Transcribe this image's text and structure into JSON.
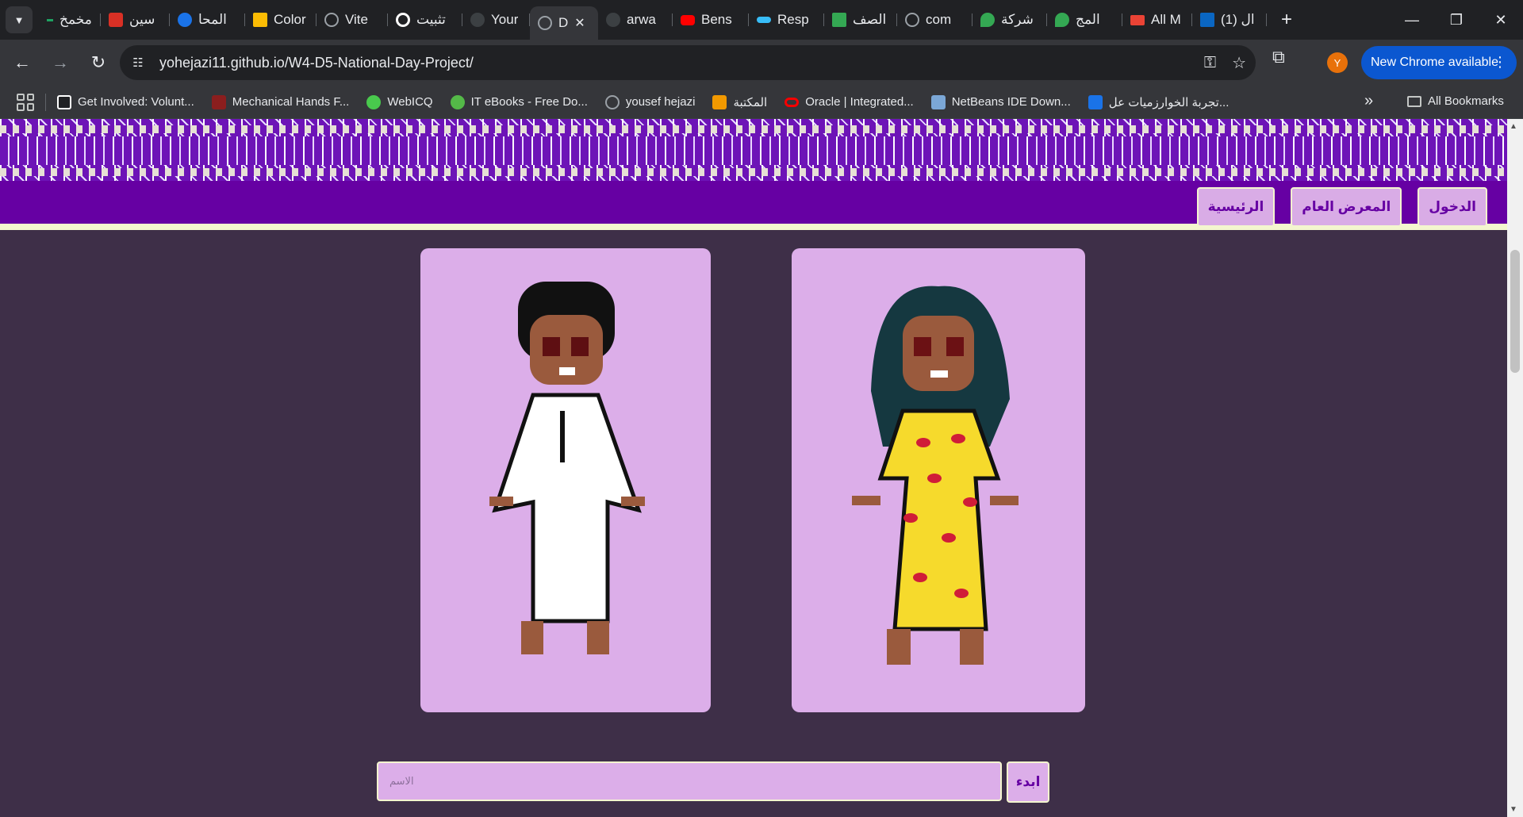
{
  "browser": {
    "tabs": [
      {
        "title": "مخمخ",
        "icon": "green-dot-icon",
        "color": "#1ea362"
      },
      {
        "title": "سين",
        "icon": "arabic-logo-icon",
        "color": "#d93025"
      },
      {
        "title": "المحا",
        "icon": "blue-circle-icon",
        "color": "#1a73e8"
      },
      {
        "title": "Color",
        "icon": "flag-icon",
        "color": "#fbbc04"
      },
      {
        "title": "Vite",
        "icon": "globe-icon",
        "color": "#9aa0a6"
      },
      {
        "title": "تثبيت",
        "icon": "openai-icon",
        "color": "#ffffff"
      },
      {
        "title": "Your",
        "icon": "github-icon",
        "color": "#9aa0a6"
      },
      {
        "title": "D",
        "icon": "globe-icon",
        "color": "#9aa0a6",
        "active": true
      },
      {
        "title": "arwa",
        "icon": "github-icon",
        "color": "#9aa0a6"
      },
      {
        "title": "Bens",
        "icon": "youtube-icon",
        "color": "#ff0000"
      },
      {
        "title": "Resp",
        "icon": "tailwind-icon",
        "color": "#38bdf8"
      },
      {
        "title": "الصف",
        "icon": "sheets-icon",
        "color": "#34a853"
      },
      {
        "title": "com",
        "icon": "globe-icon",
        "color": "#9aa0a6"
      },
      {
        "title": "شركة",
        "icon": "maps-pin-icon",
        "color": "#34a853"
      },
      {
        "title": "المج",
        "icon": "maps-pin-icon",
        "color": "#34a853"
      },
      {
        "title": "All M",
        "icon": "gmail-icon",
        "color": "#ea4335"
      },
      {
        "title": "(1) ال",
        "icon": "linkedin-icon",
        "color": "#0a66c2"
      }
    ],
    "url": "yohejazi11.github.io/W4-D5-National-Day-Project/",
    "update_label": "New Chrome available",
    "avatar_letter": "Y",
    "bookmarks": [
      {
        "label": "Get Involved: Volunt...",
        "icon": "m-icon",
        "color": "#ffffff"
      },
      {
        "label": "Mechanical Hands F...",
        "icon": "red-hand-icon",
        "color": "#8b1e1e"
      },
      {
        "label": "WebICQ",
        "icon": "flower-icon",
        "color": "#49c94d"
      },
      {
        "label": "IT eBooks - Free Do...",
        "icon": "green-ball-icon",
        "color": "#54b948"
      },
      {
        "label": "yousef hejazi",
        "icon": "globe-icon",
        "color": "#9aa0a6"
      },
      {
        "label": "المكتبة",
        "icon": "library-icon",
        "color": "#f29900"
      },
      {
        "label": "Oracle | Integrated...",
        "icon": "oracle-icon",
        "color": "#f80000"
      },
      {
        "label": "NetBeans IDE Down...",
        "icon": "netbeans-icon",
        "color": "#7ba7d6"
      },
      {
        "label": "تجربة الخوارزميات عل...",
        "icon": "h-icon",
        "color": "#1a73e8"
      }
    ],
    "all_bookmarks": "All Bookmarks"
  },
  "page": {
    "nav_buttons": [
      "الدخول",
      "المعرض العام",
      "الرئيسية"
    ],
    "name_placeholder": "الاسم",
    "start_label": "ابدء",
    "colors": {
      "background": "#3e2f48",
      "navbar": "#6600a3",
      "card": "#dcaee9",
      "accent_border": "#f4f6cf"
    },
    "characters": [
      {
        "name": "boy-thobe",
        "outfit": "white thobe"
      },
      {
        "name": "girl-dress",
        "outfit": "yellow dress with red pattern"
      }
    ]
  }
}
